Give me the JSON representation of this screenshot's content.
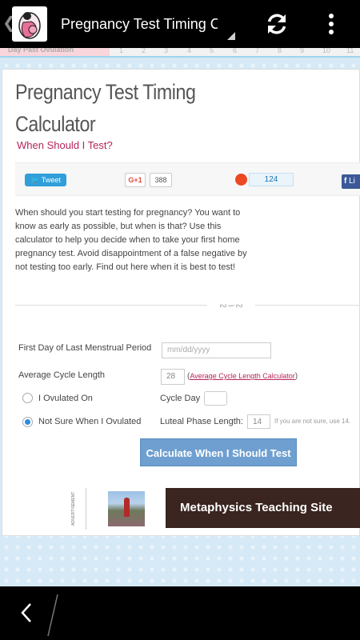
{
  "actionbar": {
    "title": "Pregnancy Test Timing Ca",
    "back_glyph": "❮",
    "icons": [
      "app-icon",
      "refresh-icon",
      "overflow-menu-icon"
    ]
  },
  "timeline": {
    "label": "Day Past Ovulation",
    "ticks": [
      "1",
      "2",
      "3",
      "4",
      "5",
      "6",
      "7",
      "8",
      "9",
      "10",
      "11"
    ]
  },
  "page": {
    "title_line1": "Pregnancy Test Timing",
    "title_line2": "Calculator",
    "subtitle": "When Should I Test?"
  },
  "social": {
    "tweet_label": "Tweet",
    "gplus_label": "G+1",
    "gplus_count": "388",
    "stumble_count": "124",
    "facebook_label": "Li"
  },
  "intro": "When should you start testing for pregnancy? You want to know as early as possible, but when is that? Use this calculator to help you decide when to take your first home pregnancy test. Avoid disappointment of a false negative by not testing too early. Find out here when it is best to test!",
  "divider_ornament": "∾∽∾",
  "form": {
    "lmp_label": "First Day of Last Menstrual Period",
    "lmp_placeholder": "mm/dd/yyyy",
    "cycle_label": "Average Cycle Length",
    "cycle_value": "28",
    "cycle_link_open": "(",
    "cycle_link": "Average Cycle Length Calculator",
    "cycle_link_close": ")",
    "radio_ovulated": "I Ovulated On",
    "cycle_day_label": "Cycle Day",
    "radio_not_sure": "Not Sure When I Ovulated",
    "luteal_label": "Luteal Phase Length:",
    "luteal_value": "14",
    "luteal_hint": "If you are not sure, use 14.",
    "selected_option": "Not Sure When I Ovulated",
    "calculate_label": "Calculate When I Should Test"
  },
  "ad": {
    "label": "ADVERTISEMENT",
    "banner": "Metaphysics Teaching Site"
  },
  "colors": {
    "accent_pink": "#b5245a",
    "button_blue": "#6e9fd0",
    "background_blue": "#d6e9f6"
  }
}
